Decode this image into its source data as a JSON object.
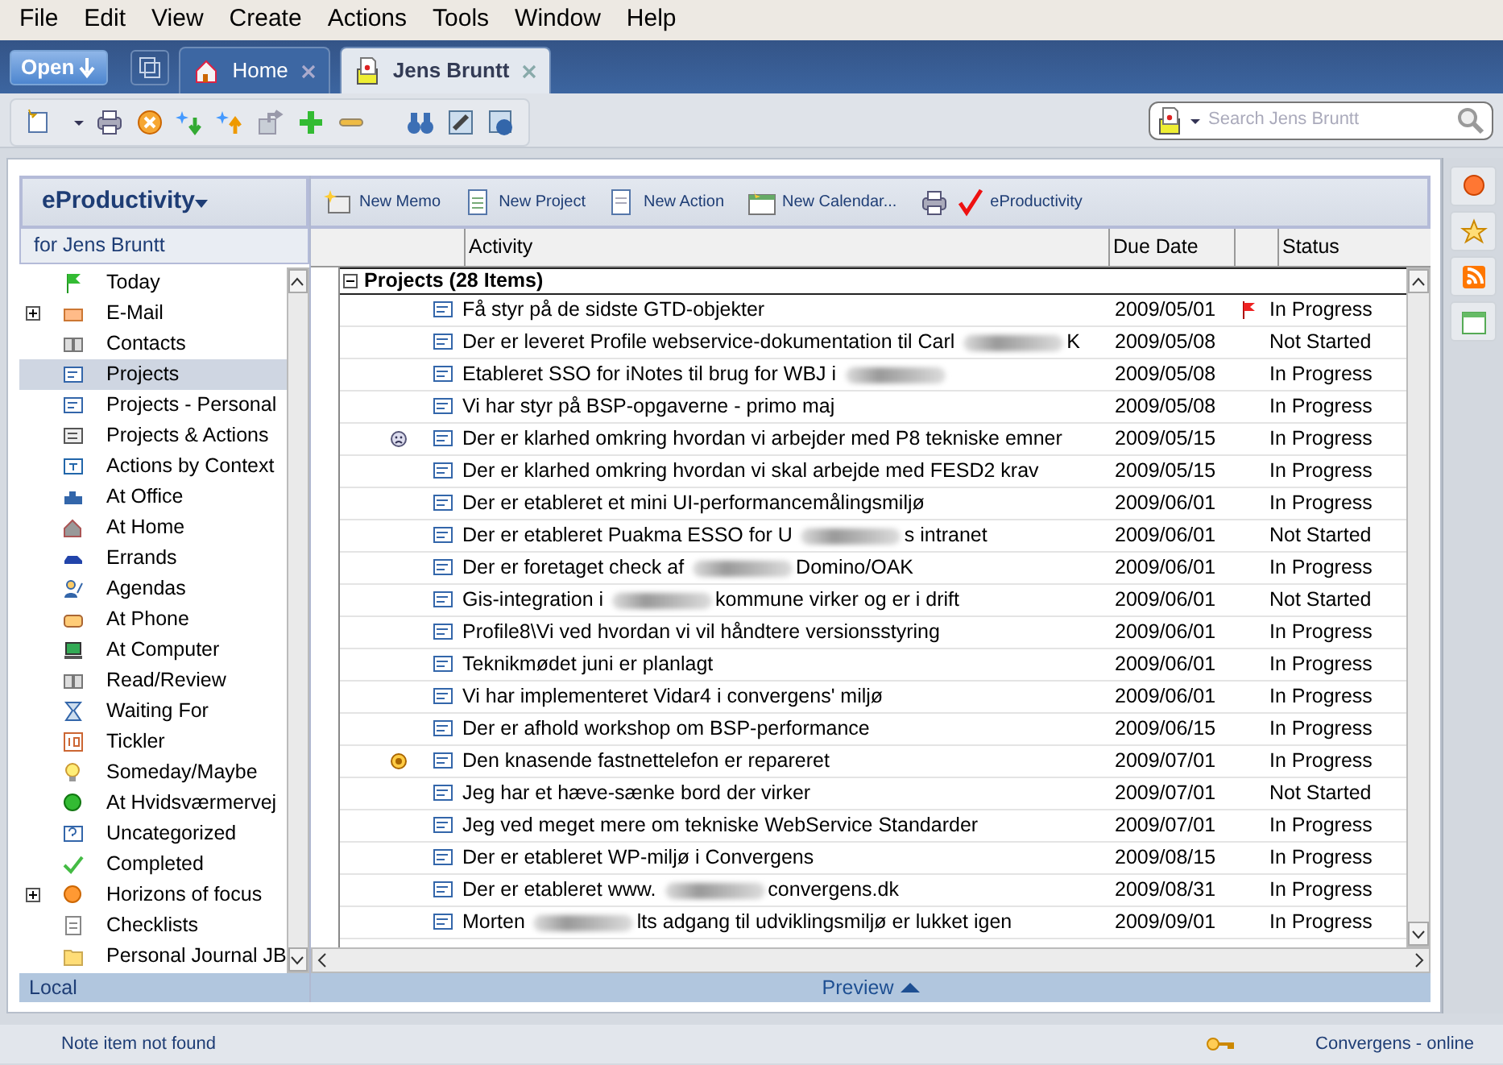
{
  "menu": [
    "File",
    "Edit",
    "View",
    "Create",
    "Actions",
    "Tools",
    "Window",
    "Help"
  ],
  "open_button": "Open",
  "tabs": [
    {
      "label": "Home",
      "selected": false
    },
    {
      "label": "Jens Bruntt",
      "selected": true
    }
  ],
  "search": {
    "placeholder": "Search Jens Bruntt"
  },
  "sidebar": {
    "title": "eProductivity",
    "subtitle": "for Jens Bruntt",
    "footer": "Local",
    "items": [
      {
        "label": "Today",
        "expandable": false,
        "selected": false
      },
      {
        "label": "E-Mail",
        "expandable": true,
        "selected": false
      },
      {
        "label": "Contacts",
        "expandable": false,
        "selected": false
      },
      {
        "label": "Projects",
        "expandable": false,
        "selected": true
      },
      {
        "label": "Projects - Personal",
        "expandable": false,
        "selected": false
      },
      {
        "label": "Projects & Actions",
        "expandable": false,
        "selected": false
      },
      {
        "label": "Actions by Context",
        "expandable": false,
        "selected": false
      },
      {
        "label": "At Office",
        "expandable": false,
        "selected": false
      },
      {
        "label": "At Home",
        "expandable": false,
        "selected": false
      },
      {
        "label": "Errands",
        "expandable": false,
        "selected": false
      },
      {
        "label": "Agendas",
        "expandable": false,
        "selected": false
      },
      {
        "label": "At Phone",
        "expandable": false,
        "selected": false
      },
      {
        "label": "At Computer",
        "expandable": false,
        "selected": false
      },
      {
        "label": "Read/Review",
        "expandable": false,
        "selected": false
      },
      {
        "label": "Waiting For",
        "expandable": false,
        "selected": false
      },
      {
        "label": "Tickler",
        "expandable": false,
        "selected": false
      },
      {
        "label": "Someday/Maybe",
        "expandable": false,
        "selected": false
      },
      {
        "label": "At Hvidsværmervej",
        "expandable": false,
        "selected": false
      },
      {
        "label": "Uncategorized",
        "expandable": false,
        "selected": false
      },
      {
        "label": "Completed",
        "expandable": false,
        "selected": false
      },
      {
        "label": "Horizons of focus",
        "expandable": true,
        "selected": false
      },
      {
        "label": "Checklists",
        "expandable": false,
        "selected": false
      },
      {
        "label": "Personal Journal JB",
        "expandable": false,
        "selected": false
      }
    ]
  },
  "actions": [
    "New Memo",
    "New Project",
    "New Action",
    "New Calendar...",
    "eProductivity"
  ],
  "table": {
    "columns": [
      "Activity",
      "Due Date",
      "Status"
    ],
    "group": {
      "label": "Projects (28 Items)",
      "expanded": true
    },
    "rows": [
      {
        "kind": "plain",
        "activity": [
          {
            "kind": "text",
            "text": "Få styr på de sidste GTD-objekter"
          }
        ],
        "due": "2009/05/01",
        "flagged": true,
        "status": "In Progress"
      },
      {
        "kind": "plain",
        "activity": [
          {
            "kind": "text",
            "text": "Der er leveret Profile webservice-dokumentation til Carl"
          },
          {
            "kind": "redacted"
          },
          {
            "kind": "text",
            "text": "K"
          }
        ],
        "due": "2009/05/08",
        "flagged": false,
        "status": "Not Started"
      },
      {
        "kind": "plain",
        "activity": [
          {
            "kind": "text",
            "text": "Etableret SSO for iNotes til brug for WBJ i"
          },
          {
            "kind": "redacted"
          }
        ],
        "due": "2009/05/08",
        "flagged": false,
        "status": "In Progress"
      },
      {
        "kind": "plain",
        "activity": [
          {
            "kind": "text",
            "text": "Vi har styr på BSP-opgaverne - primo maj"
          }
        ],
        "due": "2009/05/08",
        "flagged": false,
        "status": "In Progress"
      },
      {
        "kind": "face",
        "activity": [
          {
            "kind": "text",
            "text": "Der er klarhed omkring hvordan vi arbejder med P8 tekniske emner"
          }
        ],
        "due": "2009/05/15",
        "flagged": false,
        "status": "In Progress"
      },
      {
        "kind": "plain",
        "activity": [
          {
            "kind": "text",
            "text": "Der er klarhed omkring hvordan vi skal arbejde med FESD2 krav"
          }
        ],
        "due": "2009/05/15",
        "flagged": false,
        "status": "In Progress"
      },
      {
        "kind": "plain",
        "activity": [
          {
            "kind": "text",
            "text": "Der er etableret et mini UI-performancemålingsmiljø"
          }
        ],
        "due": "2009/06/01",
        "flagged": false,
        "status": "In Progress"
      },
      {
        "kind": "plain",
        "activity": [
          {
            "kind": "text",
            "text": "Der er etableret Puakma ESSO for U"
          },
          {
            "kind": "redacted"
          },
          {
            "kind": "text",
            "text": "s intranet"
          }
        ],
        "due": "2009/06/01",
        "flagged": false,
        "status": "Not Started"
      },
      {
        "kind": "plain",
        "activity": [
          {
            "kind": "text",
            "text": "Der er foretaget check af"
          },
          {
            "kind": "redacted"
          },
          {
            "kind": "text",
            "text": "Domino/OAK"
          }
        ],
        "due": "2009/06/01",
        "flagged": false,
        "status": "In Progress"
      },
      {
        "kind": "plain",
        "activity": [
          {
            "kind": "text",
            "text": "Gis-integration i"
          },
          {
            "kind": "redacted"
          },
          {
            "kind": "text",
            "text": "kommune virker og er i drift"
          }
        ],
        "due": "2009/06/01",
        "flagged": false,
        "status": "Not Started"
      },
      {
        "kind": "plain",
        "activity": [
          {
            "kind": "text",
            "text": "Profile8\\Vi ved hvordan vi vil håndtere versionsstyring"
          }
        ],
        "due": "2009/06/01",
        "flagged": false,
        "status": "In Progress"
      },
      {
        "kind": "plain",
        "activity": [
          {
            "kind": "text",
            "text": "Teknikmødet juni er planlagt"
          }
        ],
        "due": "2009/06/01",
        "flagged": false,
        "status": "In Progress"
      },
      {
        "kind": "plain",
        "activity": [
          {
            "kind": "text",
            "text": "Vi har implementeret Vidar4 i convergens' miljø"
          }
        ],
        "due": "2009/06/01",
        "flagged": false,
        "status": "In Progress"
      },
      {
        "kind": "plain",
        "activity": [
          {
            "kind": "text",
            "text": "Der er afhold workshop om BSP-performance"
          }
        ],
        "due": "2009/06/15",
        "flagged": false,
        "status": "In Progress"
      },
      {
        "kind": "priority",
        "activity": [
          {
            "kind": "text",
            "text": "Den knasende fastnettelefon er repareret"
          }
        ],
        "due": "2009/07/01",
        "flagged": false,
        "status": "In Progress"
      },
      {
        "kind": "plain",
        "activity": [
          {
            "kind": "text",
            "text": "Jeg har et hæve-sænke bord der virker"
          }
        ],
        "due": "2009/07/01",
        "flagged": false,
        "status": "Not Started"
      },
      {
        "kind": "plain",
        "activity": [
          {
            "kind": "text",
            "text": "Jeg ved meget mere om tekniske WebService Standarder"
          }
        ],
        "due": "2009/07/01",
        "flagged": false,
        "status": "In Progress"
      },
      {
        "kind": "plain",
        "activity": [
          {
            "kind": "text",
            "text": "Der er etableret WP-miljø i Convergens"
          }
        ],
        "due": "2009/08/15",
        "flagged": false,
        "status": "In Progress"
      },
      {
        "kind": "plain",
        "activity": [
          {
            "kind": "text",
            "text": "Der er etableret www."
          },
          {
            "kind": "redacted"
          },
          {
            "kind": "text",
            "text": "convergens.dk"
          }
        ],
        "due": "2009/08/31",
        "flagged": false,
        "status": "In Progress"
      },
      {
        "kind": "plain",
        "activity": [
          {
            "kind": "text",
            "text": "Morten"
          },
          {
            "kind": "redacted"
          },
          {
            "kind": "text",
            "text": "lts adgang til udviklingsmiljø er lukket igen"
          }
        ],
        "due": "2009/09/01",
        "flagged": false,
        "status": "In Progress"
      }
    ]
  },
  "preview": "Preview",
  "status_bar": {
    "message": "Note item not found",
    "connection": "Convergens - online"
  }
}
